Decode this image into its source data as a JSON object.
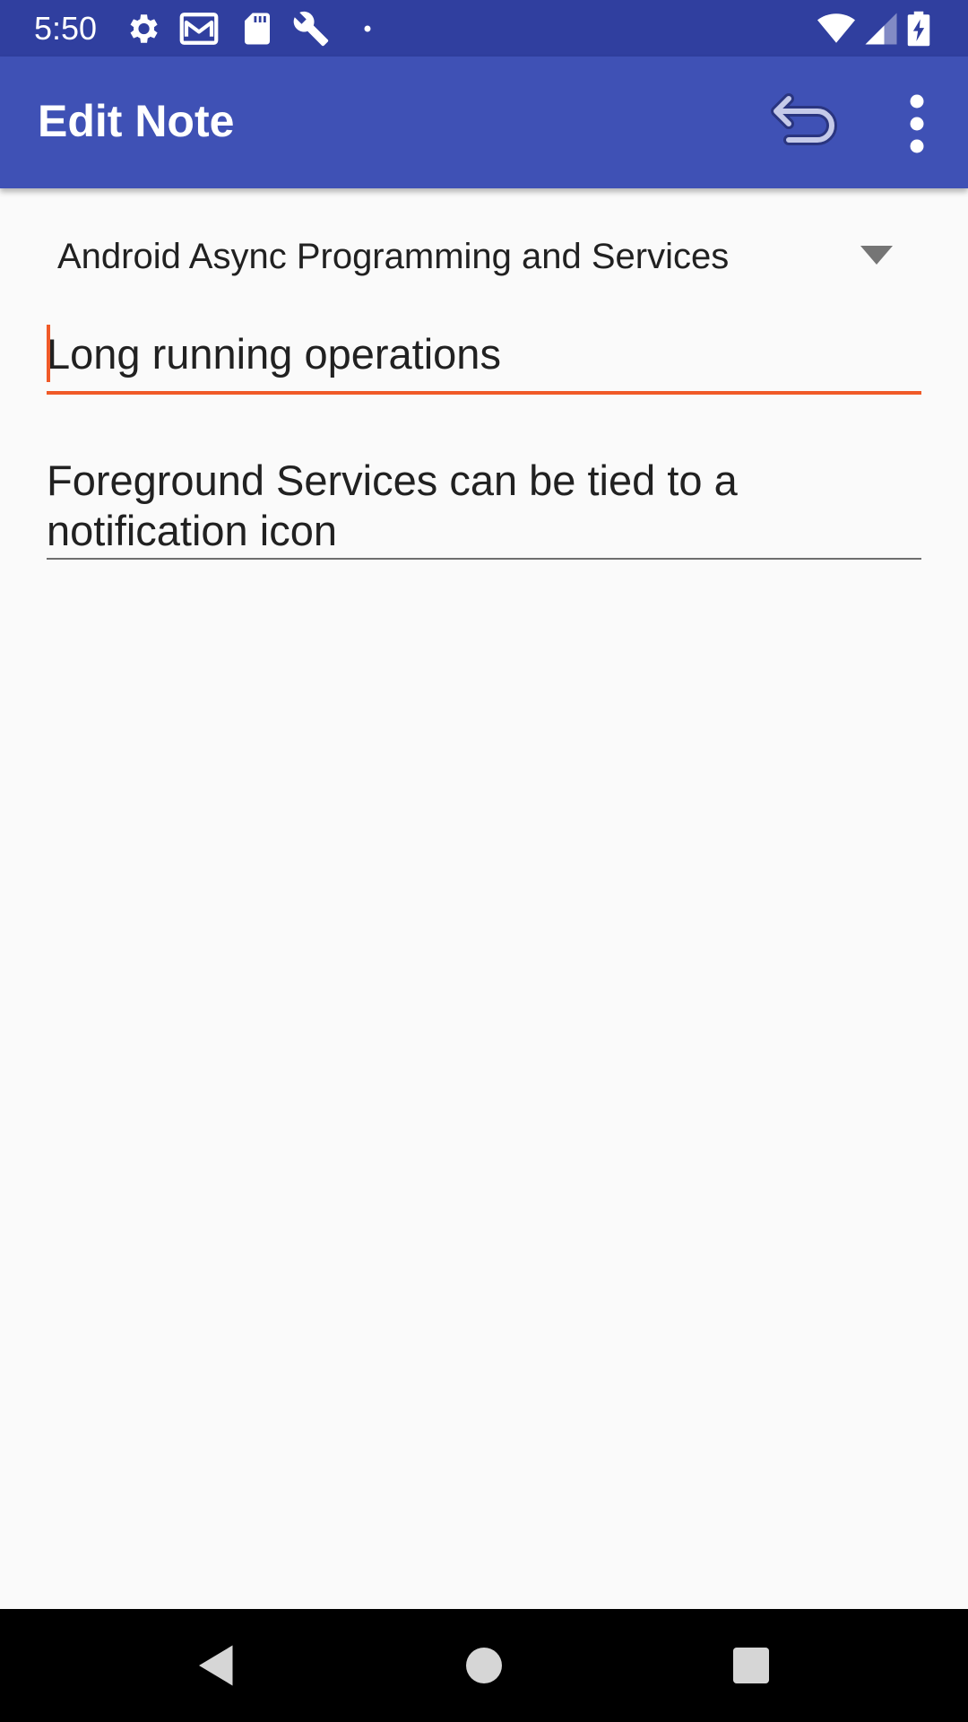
{
  "status_bar": {
    "time": "5:50",
    "left_icons": [
      "gear-icon",
      "gmail-icon",
      "sd-card-icon",
      "wrench-icon",
      "dot-icon"
    ],
    "right_icons": [
      "wifi-icon",
      "signal-icon",
      "battery-charging-icon"
    ]
  },
  "app_bar": {
    "title": "Edit Note",
    "actions": [
      "undo-icon",
      "more-vert-icon"
    ]
  },
  "note": {
    "course": "Android Async Programming and Services",
    "title_value": "Long running operations",
    "text_value": "Foreground Services can be tied to a notification icon"
  },
  "nav_bar": {
    "buttons": [
      "back-icon",
      "home-icon",
      "recents-icon"
    ]
  },
  "colors": {
    "status_bar": "#303f9f",
    "app_bar": "#3f51b5",
    "accent": "#f05a28",
    "background": "#fafafa",
    "nav_bar": "#000000"
  }
}
